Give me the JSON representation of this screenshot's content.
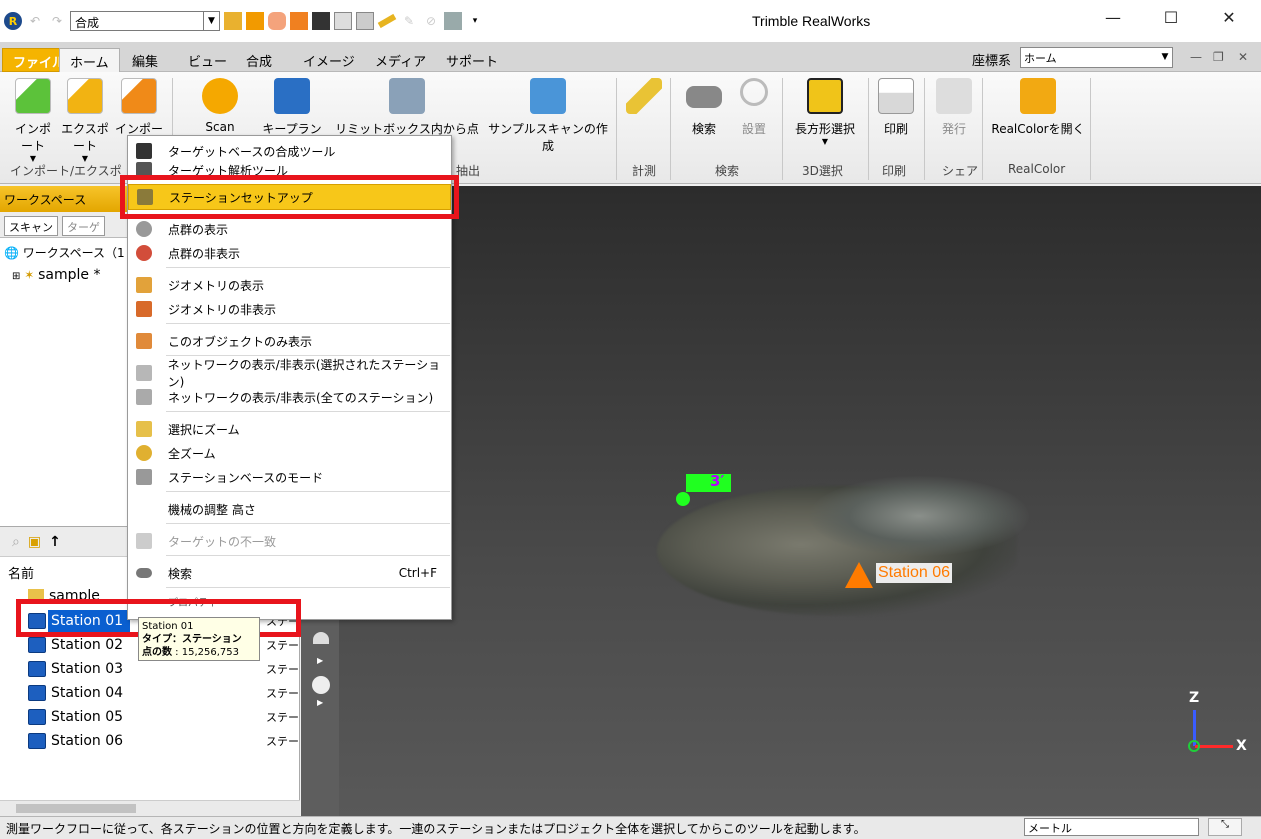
{
  "titlebar": {
    "app_title": "Trimble RealWorks",
    "combo_value": "合成"
  },
  "tabs": [
    "ファイル",
    "ホーム",
    "編集",
    "ビュー",
    "合成",
    "イメージ",
    "メディア",
    "サポート"
  ],
  "coordinate": {
    "label": "座標系",
    "value": "ホーム"
  },
  "ribbon": {
    "buttons": {
      "import": "インポート",
      "export": "エクスポート",
      "import_opt": "インポート",
      "scan": "Scan",
      "keyplan": "キープラン",
      "limitbox": "リミットボックス内から点抽出",
      "sample": "サンプルスキャンの作成",
      "search": "検索",
      "setup": "設置",
      "rect": "長方形選択",
      "print": "印刷",
      "publish": "発行",
      "realcolor": "RealColorを開く"
    },
    "groups": {
      "import": "インポート/エクスポ",
      "extract": "抽出",
      "measure": "計測",
      "search": "検索",
      "select3d": "3D選択",
      "print": "印刷",
      "share": "シェア",
      "realcolor": "RealColor"
    }
  },
  "workspace": {
    "header": "ワークスペース",
    "tab_scan": "スキャン",
    "tab_target": "ターゲ",
    "root": "ワークスペース（1 プ",
    "project": "sample *"
  },
  "list": {
    "column": "名前",
    "folder": "sample",
    "kind": "ステー",
    "stations": [
      "Station 01",
      "Station 02",
      "Station 03",
      "Station 04",
      "Station 05",
      "Station 06"
    ]
  },
  "tooltip": {
    "name": "Station 01",
    "type_line": "タイプ：ステーション",
    "points_label": "点の数",
    "points_value": "15,256,753"
  },
  "menu": {
    "items": [
      "ターゲットベースの合成ツール",
      "ターゲット解析ツール",
      "ステーションセットアップ",
      "点群の表示",
      "点群の非表示",
      "ジオメトリの表示",
      "ジオメトリの非表示",
      "このオブジェクトのみ表示",
      "ネットワークの表示/非表示(選択されたステーション)",
      "ネットワークの表示/非表示(全てのステーション)",
      "選択にズーム",
      "全ズーム",
      "ステーションベースのモード",
      "機械の調整 高さ",
      "ターゲットの不一致",
      "検索",
      "プロパティ"
    ],
    "search_shortcut": "Ctrl+F"
  },
  "viewport": {
    "station_label": "Station 06",
    "target_label": "3′",
    "axis_z": "Z",
    "axis_x": "X"
  },
  "status": {
    "message": "測量ワークフローに従って、各ステーションの位置と方向を定義します。一連のステーションまたはプロジェクト全体を選択してからこのツールを起動します。",
    "unit": "メートル"
  }
}
